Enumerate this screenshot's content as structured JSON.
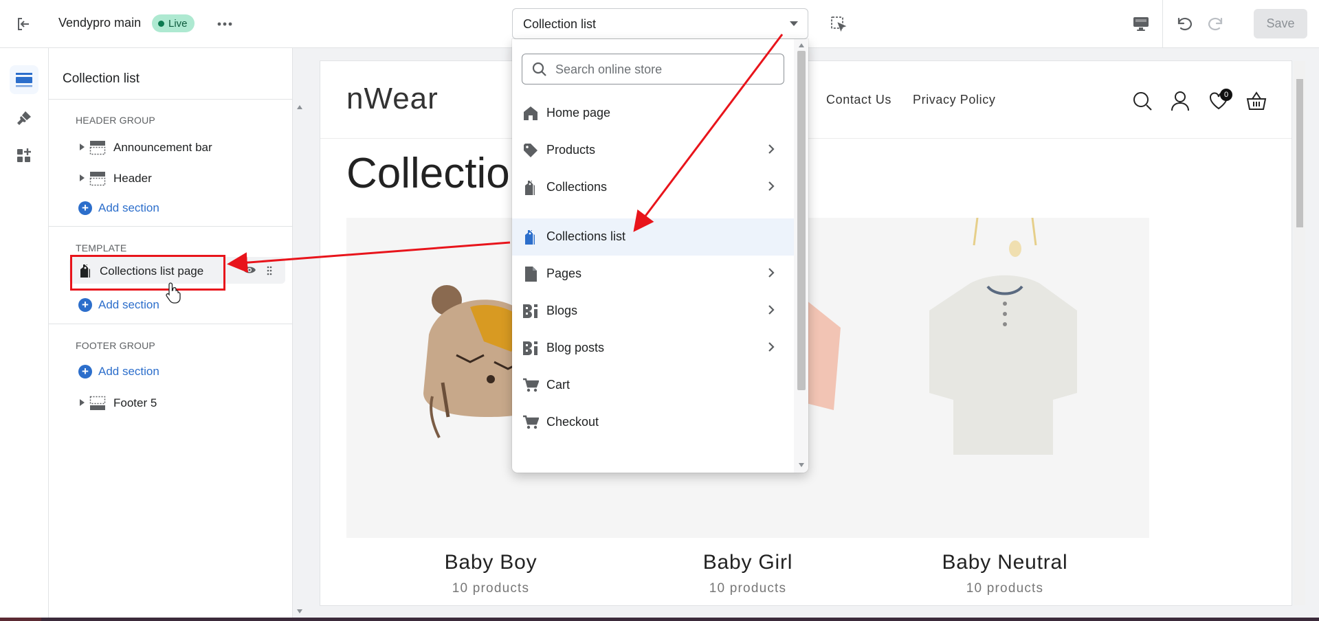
{
  "topbar": {
    "theme_name": "Vendypro main",
    "status_badge": "Live",
    "template_selected": "Collection list",
    "save_label": "Save"
  },
  "panel": {
    "title": "Collection list",
    "header_group": {
      "label": "HEADER GROUP",
      "items": [
        "Announcement bar",
        "Header"
      ],
      "add_label": "Add section"
    },
    "template_group": {
      "label": "TEMPLATE",
      "item": "Collections list page",
      "add_label": "Add section"
    },
    "footer_group": {
      "label": "FOOTER GROUP",
      "add_label": "Add section",
      "items": [
        "Footer 5"
      ]
    }
  },
  "dropdown": {
    "search_placeholder": "Search online store",
    "items": [
      {
        "label": "Home page",
        "icon": "home-icon",
        "chevron": false
      },
      {
        "label": "Products",
        "icon": "tag-icon",
        "chevron": true
      },
      {
        "label": "Collections",
        "icon": "collection-icon",
        "chevron": true
      },
      {
        "label": "Collections list",
        "icon": "collection-icon",
        "chevron": false,
        "selected": true
      },
      {
        "label": "Pages",
        "icon": "page-icon",
        "chevron": true
      },
      {
        "label": "Blogs",
        "icon": "blog-icon",
        "chevron": true
      },
      {
        "label": "Blog posts",
        "icon": "blog-icon",
        "chevron": true
      },
      {
        "label": "Cart",
        "icon": "cart-icon",
        "chevron": false
      },
      {
        "label": "Checkout",
        "icon": "cart-icon",
        "chevron": false
      }
    ]
  },
  "preview": {
    "logo": "nWear",
    "nav": [
      "Contact Us",
      "Privacy Policy"
    ],
    "wishlist_count": "0",
    "heading": "Collectio",
    "collections": [
      {
        "title": "Baby Boy",
        "count": "10 products"
      },
      {
        "title": "Baby Girl",
        "count": "10 products"
      },
      {
        "title": "Baby Neutral",
        "count": "10 products"
      }
    ]
  },
  "colors": {
    "accent": "#2c6ecb",
    "annotation": "#e8141b",
    "live_badge": "#aee9d1"
  }
}
